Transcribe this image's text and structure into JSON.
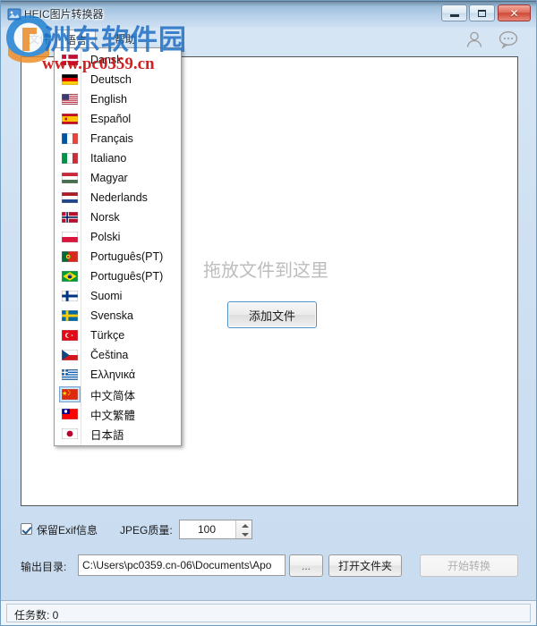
{
  "window": {
    "title": "HEIC图片转换器",
    "controls": {
      "minimize": "最小化",
      "maximize": "最大化",
      "close": "✕"
    }
  },
  "menubar": {
    "items": [
      {
        "id": "file",
        "label": "文件"
      },
      {
        "id": "language",
        "label": "语言"
      },
      {
        "id": "help",
        "label": "帮助"
      }
    ],
    "tools": [
      {
        "id": "account",
        "icon": "user-icon"
      },
      {
        "id": "feedback",
        "icon": "speech-bubble-icon"
      }
    ]
  },
  "language_menu": {
    "open": true,
    "selected": "中文简体",
    "items": [
      {
        "label": "Dansk",
        "flag": "dk"
      },
      {
        "label": "Deutsch",
        "flag": "de"
      },
      {
        "label": "English",
        "flag": "us"
      },
      {
        "label": "Español",
        "flag": "es"
      },
      {
        "label": "Français",
        "flag": "fr"
      },
      {
        "label": "Italiano",
        "flag": "it"
      },
      {
        "label": "Magyar",
        "flag": "hu"
      },
      {
        "label": "Nederlands",
        "flag": "nl"
      },
      {
        "label": "Norsk",
        "flag": "no"
      },
      {
        "label": "Polski",
        "flag": "pl"
      },
      {
        "label": "Português(PT)",
        "flag": "pt"
      },
      {
        "label": "Português(PT)",
        "flag": "br"
      },
      {
        "label": "Suomi",
        "flag": "fi"
      },
      {
        "label": "Svenska",
        "flag": "se"
      },
      {
        "label": "Türkçe",
        "flag": "tr"
      },
      {
        "label": "Čeština",
        "flag": "cz"
      },
      {
        "label": "Ελληνικά",
        "flag": "gr"
      },
      {
        "label": "中文简体",
        "flag": "cn"
      },
      {
        "label": "中文繁體",
        "flag": "tw"
      },
      {
        "label": "日本語",
        "flag": "jp"
      }
    ]
  },
  "drop_area": {
    "hint_text": "拖放文件到这里",
    "add_button": "添加文件"
  },
  "options": {
    "keep_exif_label": "保留Exif信息",
    "keep_exif_checked": true,
    "jpeg_quality_label": "JPEG质量:",
    "jpeg_quality_value": "100"
  },
  "output": {
    "label": "输出目录:",
    "path": "C:\\Users\\pc0359.cn-06\\Documents\\Apo",
    "browse_button": "...",
    "open_folder_button": "打开文件夹",
    "convert_button": "开始转换",
    "convert_enabled": false
  },
  "statusbar": {
    "text": "任务数: 0"
  },
  "watermark": {
    "site_name": "洲东软件园",
    "url": "www.pc0359.cn",
    "brand_color": "#1f6fc4",
    "url_color": "#cc1111"
  }
}
